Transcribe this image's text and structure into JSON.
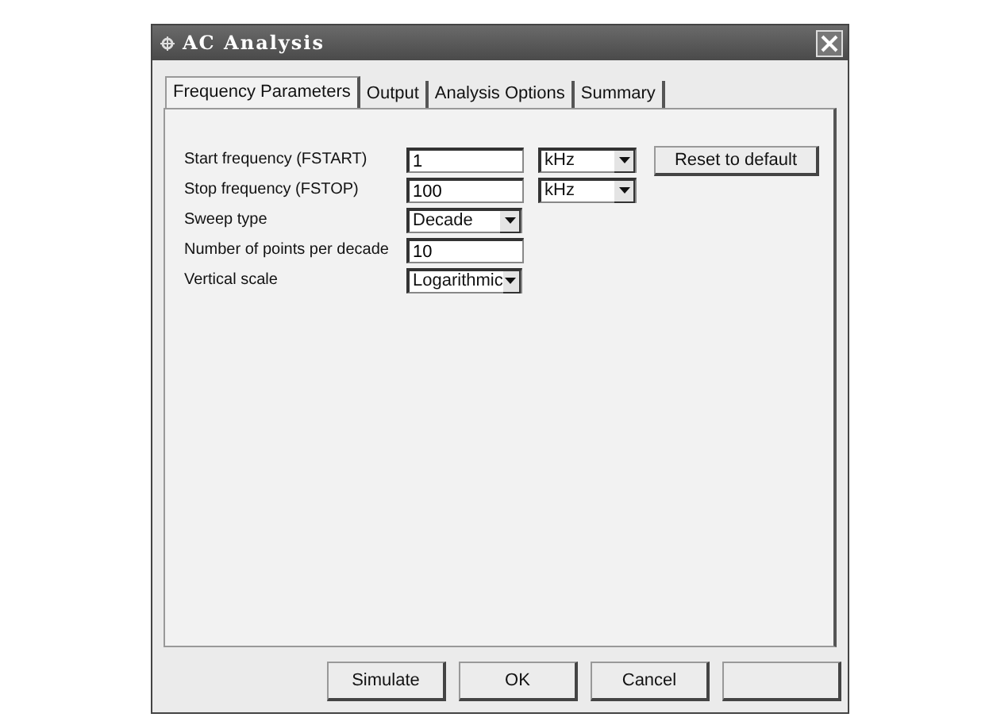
{
  "window": {
    "title": "AC Analysis"
  },
  "tabs": [
    {
      "label": "Frequency Parameters",
      "selected": true
    },
    {
      "label": "Output",
      "selected": false
    },
    {
      "label": "Analysis Options",
      "selected": false
    },
    {
      "label": "Summary",
      "selected": false
    }
  ],
  "fields": [
    {
      "label": "Start frequency (FSTART)",
      "kind": "text",
      "value": "1",
      "unit": "kHz"
    },
    {
      "label": "Stop frequency (FSTOP)",
      "kind": "text",
      "value": "100",
      "unit": "kHz"
    },
    {
      "label": "Sweep type",
      "kind": "select",
      "value": "Decade"
    },
    {
      "label": "Number of points per decade",
      "kind": "text",
      "value": "10"
    },
    {
      "label": "Vertical scale",
      "kind": "select",
      "value": "Logarithmic"
    }
  ],
  "reset_button": "Reset to default",
  "buttons": [
    {
      "kind": "text",
      "label": "Simulate"
    },
    {
      "kind": "text",
      "label": "OK"
    },
    {
      "kind": "text",
      "label": "Cancel"
    },
    {
      "kind": "blank"
    }
  ]
}
